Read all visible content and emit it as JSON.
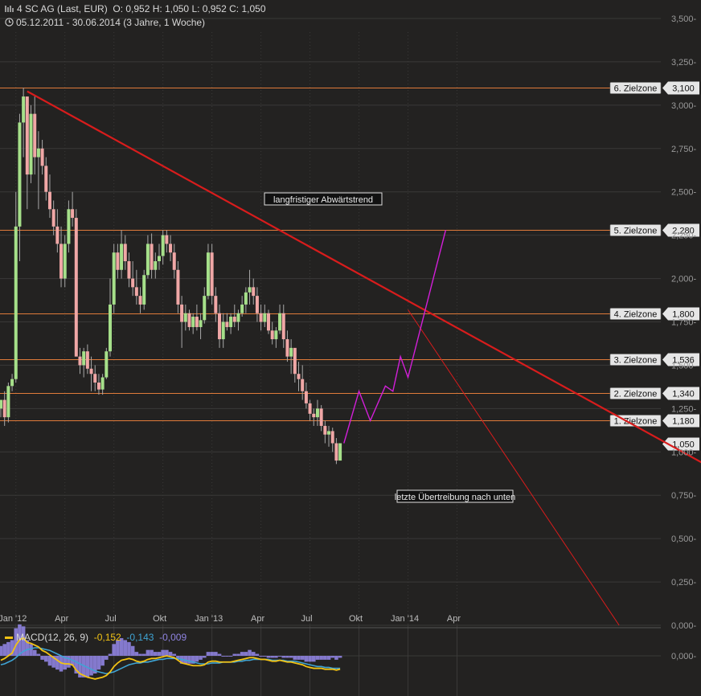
{
  "header": {
    "instrument": "4 SC AG (Last, EUR)",
    "ohlc": "O: 0,952  H: 1,050  L: 0,952  C: 1,050",
    "range": "05.12.2011 - 30.06.2014 (3 Jahre, 1 Woche)",
    "chart_icon": "bar-chart-icon",
    "clock_icon": "clock-icon"
  },
  "colors": {
    "background": "#232221",
    "grid": "#3a3938",
    "up_candle": "#a6e08a",
    "down_candle": "#f0a7a6",
    "trendline": "#d81c1c",
    "zone_line": "#e07b3a",
    "projection": "#d21fd8",
    "macd_line": "#f2c314",
    "signal_line": "#3fa4d4",
    "histogram": "#8f83e0"
  },
  "chart_data": {
    "type": "candlestick",
    "x_labels": [
      "Jan '12",
      "Apr",
      "Jul",
      "Okt",
      "Jan '13",
      "Apr",
      "Jul",
      "Okt",
      "Jan '14",
      "Apr"
    ],
    "y_ticks": [
      "0,000",
      "0,250",
      "0,500",
      "0,750",
      "1,000",
      "1,250",
      "1,500",
      "1,750",
      "2,000",
      "2,250",
      "2,500",
      "2,750",
      "3,000",
      "3,250",
      "3,500"
    ],
    "ylim": [
      0,
      3.5
    ],
    "price_scale": {
      "v0": 0,
      "y0": 778,
      "v1": 3.5,
      "y1": 23
    },
    "time_scale": {
      "first_week_x": 1,
      "week_step": 4.69
    },
    "candles": [
      [
        1.25,
        1.3,
        1.2,
        1.3
      ],
      [
        1.3,
        1.35,
        1.15,
        1.2
      ],
      [
        1.2,
        1.4,
        1.17,
        1.38
      ],
      [
        1.38,
        1.45,
        1.35,
        1.42
      ],
      [
        1.42,
        2.5,
        1.4,
        2.3
      ],
      [
        2.3,
        2.95,
        2.1,
        2.9
      ],
      [
        2.9,
        3.1,
        2.7,
        3.05
      ],
      [
        3.05,
        3.0,
        2.4,
        2.6
      ],
      [
        2.6,
        3.0,
        2.55,
        2.95
      ],
      [
        2.95,
        3.05,
        2.6,
        2.7
      ],
      [
        2.7,
        2.85,
        2.4,
        2.75
      ],
      [
        2.75,
        2.8,
        2.6,
        2.65
      ],
      [
        2.65,
        2.7,
        2.45,
        2.5
      ],
      [
        2.5,
        2.6,
        2.35,
        2.4
      ],
      [
        2.4,
        2.45,
        2.25,
        2.3
      ],
      [
        2.3,
        2.4,
        2.15,
        2.2
      ],
      [
        2.2,
        2.3,
        1.95,
        2.0
      ],
      [
        2.0,
        2.25,
        1.95,
        2.2
      ],
      [
        2.2,
        2.45,
        2.15,
        2.4
      ],
      [
        2.4,
        2.5,
        2.3,
        2.35
      ],
      [
        2.35,
        2.4,
        1.55,
        1.55
      ],
      [
        1.55,
        1.6,
        1.45,
        1.5
      ],
      [
        1.5,
        1.6,
        1.43,
        1.58
      ],
      [
        1.58,
        1.62,
        1.45,
        1.48
      ],
      [
        1.48,
        1.55,
        1.35,
        1.45
      ],
      [
        1.45,
        1.5,
        1.35,
        1.4
      ],
      [
        1.4,
        1.45,
        1.33,
        1.36
      ],
      [
        1.36,
        1.45,
        1.33,
        1.43
      ],
      [
        1.43,
        1.6,
        1.42,
        1.58
      ],
      [
        1.58,
        2.0,
        1.55,
        1.85
      ],
      [
        1.85,
        2.2,
        1.8,
        2.15
      ],
      [
        2.15,
        2.2,
        2.0,
        2.05
      ],
      [
        2.05,
        2.28,
        2.0,
        2.2
      ],
      [
        2.2,
        2.25,
        2.05,
        2.1
      ],
      [
        2.1,
        2.15,
        1.95,
        2.0
      ],
      [
        2.0,
        2.1,
        1.9,
        1.95
      ],
      [
        1.95,
        2.05,
        1.85,
        1.9
      ],
      [
        1.9,
        1.95,
        1.8,
        1.85
      ],
      [
        1.85,
        2.05,
        1.82,
        2.02
      ],
      [
        2.02,
        2.25,
        2.0,
        2.2
      ],
      [
        2.2,
        2.26,
        2.0,
        2.05
      ],
      [
        2.05,
        2.15,
        2.0,
        2.1
      ],
      [
        2.1,
        2.2,
        2.05,
        2.13
      ],
      [
        2.13,
        2.28,
        2.08,
        2.25
      ],
      [
        2.25,
        2.28,
        2.15,
        2.2
      ],
      [
        2.2,
        2.25,
        2.1,
        2.15
      ],
      [
        2.15,
        2.2,
        2.0,
        2.05
      ],
      [
        2.05,
        2.1,
        1.8,
        1.85
      ],
      [
        1.85,
        1.9,
        1.6,
        1.75
      ],
      [
        1.75,
        1.85,
        1.7,
        1.8
      ],
      [
        1.8,
        1.82,
        1.7,
        1.72
      ],
      [
        1.72,
        1.8,
        1.68,
        1.78
      ],
      [
        1.78,
        1.85,
        1.7,
        1.72
      ],
      [
        1.72,
        1.8,
        1.65,
        1.76
      ],
      [
        1.76,
        1.95,
        1.74,
        1.9
      ],
      [
        1.9,
        2.2,
        1.88,
        2.15
      ],
      [
        2.15,
        2.2,
        1.85,
        1.9
      ],
      [
        1.9,
        1.95,
        1.75,
        1.8
      ],
      [
        1.8,
        1.85,
        1.6,
        1.65
      ],
      [
        1.65,
        1.8,
        1.6,
        1.75
      ],
      [
        1.75,
        1.8,
        1.7,
        1.72
      ],
      [
        1.72,
        1.8,
        1.68,
        1.78
      ],
      [
        1.78,
        1.85,
        1.72,
        1.75
      ],
      [
        1.75,
        1.82,
        1.7,
        1.8
      ],
      [
        1.8,
        1.9,
        1.78,
        1.85
      ],
      [
        1.85,
        1.95,
        1.8,
        1.92
      ],
      [
        1.92,
        2.05,
        1.85,
        1.95
      ],
      [
        1.95,
        2.0,
        1.85,
        1.9
      ],
      [
        1.9,
        1.95,
        1.75,
        1.8
      ],
      [
        1.8,
        1.85,
        1.7,
        1.75
      ],
      [
        1.75,
        1.85,
        1.72,
        1.8
      ],
      [
        1.8,
        1.82,
        1.68,
        1.7
      ],
      [
        1.7,
        1.75,
        1.62,
        1.65
      ],
      [
        1.65,
        1.72,
        1.6,
        1.7
      ],
      [
        1.7,
        1.85,
        1.68,
        1.8
      ],
      [
        1.8,
        1.85,
        1.6,
        1.65
      ],
      [
        1.65,
        1.7,
        1.52,
        1.55
      ],
      [
        1.55,
        1.65,
        1.45,
        1.6
      ],
      [
        1.6,
        1.58,
        1.4,
        1.45
      ],
      [
        1.45,
        1.52,
        1.35,
        1.42
      ],
      [
        1.42,
        1.5,
        1.3,
        1.35
      ],
      [
        1.35,
        1.4,
        1.25,
        1.28
      ],
      [
        1.28,
        1.3,
        1.18,
        1.22
      ],
      [
        1.22,
        1.25,
        1.15,
        1.2
      ],
      [
        1.2,
        1.3,
        1.15,
        1.25
      ],
      [
        1.25,
        1.27,
        1.12,
        1.15
      ],
      [
        1.15,
        1.18,
        1.05,
        1.1
      ],
      [
        1.1,
        1.15,
        1.03,
        1.12
      ],
      [
        1.12,
        1.14,
        1.0,
        1.05
      ],
      [
        1.05,
        1.08,
        0.93,
        0.95
      ],
      [
        0.95,
        1.05,
        0.95,
        1.05
      ]
    ],
    "zones": [
      {
        "label": "6. Zielzone",
        "value": 3.1,
        "value_text": "3,100"
      },
      {
        "label": "5. Zielzone",
        "value": 2.28,
        "value_text": "2,280"
      },
      {
        "label": "4. Zielzone",
        "value": 1.8,
        "value_text": "1,800"
      },
      {
        "label": "3. Zielzone",
        "value": 1.536,
        "value_text": "1,536"
      },
      {
        "label": "2. Zielzone",
        "value": 1.34,
        "value_text": "1,340"
      },
      {
        "label": "1. Zielzone",
        "value": 1.18,
        "value_text": "1,180"
      }
    ],
    "last_price": {
      "value": 1.05,
      "value_text": "1,050"
    },
    "annotations": [
      "langfristiger Abwärtstrend",
      "letzte Übertreibung nach unten"
    ],
    "trendline_long": [
      [
        7,
        3.08
      ],
      [
        190,
        0.89
      ]
    ],
    "trendline_short": [
      [
        108,
        1.82
      ],
      [
        164,
        0.0
      ]
    ],
    "projection": [
      [
        91,
        1.05
      ],
      [
        95,
        1.35
      ],
      [
        98,
        1.18
      ],
      [
        102,
        1.38
      ],
      [
        104,
        1.35
      ],
      [
        106,
        1.55
      ],
      [
        108,
        1.43
      ],
      [
        118,
        2.28
      ]
    ],
    "macd": {
      "legend": "MACD(12, 26, 9)",
      "value_macd": "-0,152",
      "value_signal": "-0,143",
      "value_hist": "-0,009",
      "y_tick": "0,000",
      "ylim": [
        -0.45,
        0.15
      ],
      "macd_line": [
        -0.05,
        -0.03,
        0.0,
        0.03,
        0.12,
        0.18,
        0.2,
        0.15,
        0.14,
        0.12,
        0.1,
        0.06,
        0.04,
        0.01,
        -0.02,
        -0.05,
        -0.08,
        -0.09,
        -0.09,
        -0.1,
        -0.16,
        -0.2,
        -0.22,
        -0.24,
        -0.25,
        -0.26,
        -0.25,
        -0.24,
        -0.22,
        -0.18,
        -0.12,
        -0.08,
        -0.05,
        -0.04,
        -0.03,
        -0.04,
        -0.06,
        -0.07,
        -0.06,
        -0.04,
        -0.03,
        -0.03,
        -0.02,
        -0.01,
        0.0,
        -0.01,
        -0.02,
        -0.05,
        -0.08,
        -0.09,
        -0.1,
        -0.11,
        -0.11,
        -0.11,
        -0.1,
        -0.07,
        -0.06,
        -0.06,
        -0.07,
        -0.07,
        -0.07,
        -0.07,
        -0.06,
        -0.05,
        -0.04,
        -0.03,
        -0.02,
        -0.02,
        -0.03,
        -0.04,
        -0.04,
        -0.05,
        -0.06,
        -0.06,
        -0.05,
        -0.06,
        -0.07,
        -0.07,
        -0.08,
        -0.09,
        -0.1,
        -0.12,
        -0.13,
        -0.14,
        -0.14,
        -0.14,
        -0.15,
        -0.15,
        -0.15,
        -0.16,
        -0.15
      ],
      "signal_line": [
        -0.1,
        -0.09,
        -0.07,
        -0.05,
        -0.02,
        0.02,
        0.05,
        0.07,
        0.08,
        0.09,
        0.09,
        0.08,
        0.07,
        0.06,
        0.04,
        0.02,
        0.0,
        -0.02,
        -0.03,
        -0.05,
        -0.07,
        -0.09,
        -0.11,
        -0.13,
        -0.15,
        -0.17,
        -0.18,
        -0.19,
        -0.2,
        -0.19,
        -0.18,
        -0.16,
        -0.14,
        -0.12,
        -0.1,
        -0.09,
        -0.08,
        -0.08,
        -0.07,
        -0.07,
        -0.06,
        -0.05,
        -0.04,
        -0.04,
        -0.03,
        -0.03,
        -0.03,
        -0.03,
        -0.04,
        -0.05,
        -0.06,
        -0.07,
        -0.08,
        -0.09,
        -0.09,
        -0.09,
        -0.08,
        -0.08,
        -0.08,
        -0.07,
        -0.07,
        -0.07,
        -0.07,
        -0.06,
        -0.06,
        -0.05,
        -0.05,
        -0.04,
        -0.04,
        -0.04,
        -0.04,
        -0.04,
        -0.05,
        -0.05,
        -0.05,
        -0.05,
        -0.06,
        -0.06,
        -0.06,
        -0.07,
        -0.08,
        -0.09,
        -0.1,
        -0.11,
        -0.12,
        -0.12,
        -0.13,
        -0.13,
        -0.14,
        -0.14,
        -0.14
      ]
    }
  }
}
